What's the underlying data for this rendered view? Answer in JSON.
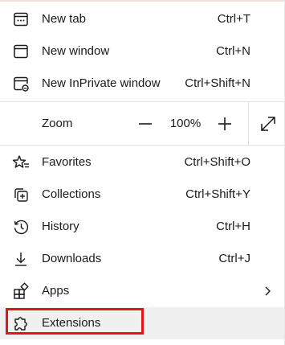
{
  "menu": {
    "new_tab": {
      "label": "New tab",
      "shortcut": "Ctrl+T",
      "icon": "new-tab-icon"
    },
    "new_window": {
      "label": "New window",
      "shortcut": "Ctrl+N",
      "icon": "new-window-icon"
    },
    "new_inprivate": {
      "label": "New InPrivate window",
      "shortcut": "Ctrl+Shift+N",
      "icon": "inprivate-window-icon"
    },
    "zoom": {
      "label": "Zoom",
      "value": "100%",
      "decrease_icon": "minus-icon",
      "increase_icon": "plus-icon",
      "fullscreen_icon": "fullscreen-icon"
    },
    "favorites": {
      "label": "Favorites",
      "shortcut": "Ctrl+Shift+O",
      "icon": "star-list-icon"
    },
    "collections": {
      "label": "Collections",
      "shortcut": "Ctrl+Shift+Y",
      "icon": "collections-icon"
    },
    "history": {
      "label": "History",
      "shortcut": "Ctrl+H",
      "icon": "history-icon"
    },
    "downloads": {
      "label": "Downloads",
      "shortcut": "Ctrl+J",
      "icon": "download-icon"
    },
    "apps": {
      "label": "Apps",
      "icon": "apps-icon",
      "submenu_icon": "chevron-right-icon"
    },
    "extensions": {
      "label": "Extensions",
      "icon": "puzzle-icon",
      "highlighted": true
    }
  },
  "colors": {
    "highlight_background": "#f0f0f0",
    "annotation_border": "#e0151c",
    "text": "#1a1a1a"
  }
}
